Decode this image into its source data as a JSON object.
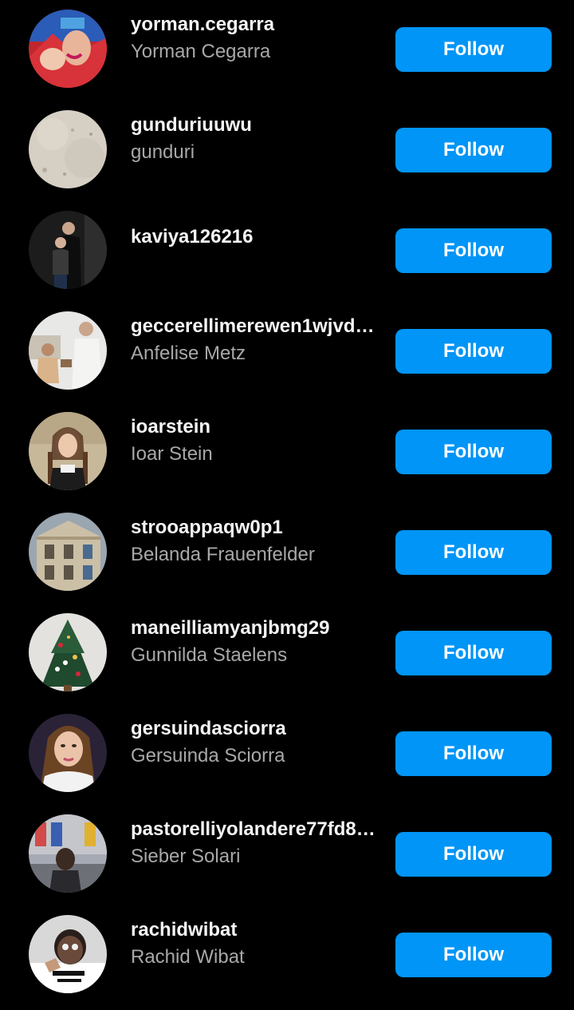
{
  "colors": {
    "background": "#000000",
    "follow_button": "#0095f6",
    "username_text": "#f5f5f5",
    "fullname_text": "#a8a8a8"
  },
  "users": [
    {
      "username": "yorman.cegarra",
      "fullname": "Yorman Cegarra",
      "follow_label": "Follow",
      "avatar": "photo-red-selfie"
    },
    {
      "username": "gunduriuuwu",
      "fullname": "gunduri",
      "follow_label": "Follow",
      "avatar": "photo-beige-texture"
    },
    {
      "username": "kaviya126216",
      "fullname": "",
      "follow_label": "Follow",
      "avatar": "photo-couple-dark"
    },
    {
      "username": "geccerellimerewen1wjvd0...",
      "fullname": "Anfelise Metz",
      "follow_label": "Follow",
      "avatar": "photo-people-outdoor"
    },
    {
      "username": "ioarstein",
      "fullname": "Ioar Stein",
      "follow_label": "Follow",
      "avatar": "photo-woman-braids"
    },
    {
      "username": "strooappaqw0p1",
      "fullname": "Belanda Frauenfelder",
      "follow_label": "Follow",
      "avatar": "photo-building"
    },
    {
      "username": "maneilliamyanjbmg29",
      "fullname": "Gunnilda Staelens",
      "follow_label": "Follow",
      "avatar": "photo-christmas-tree"
    },
    {
      "username": "gersuindasciorra",
      "fullname": "Gersuinda Sciorra",
      "follow_label": "Follow",
      "avatar": "photo-woman-portrait"
    },
    {
      "username": "pastorelliyolandere77fd8g...",
      "fullname": "Sieber Solari",
      "follow_label": "Follow",
      "avatar": "photo-woman-street"
    },
    {
      "username": "rachidwibat",
      "fullname": "Rachid Wibat",
      "follow_label": "Follow",
      "avatar": "photo-man-selfie"
    }
  ]
}
